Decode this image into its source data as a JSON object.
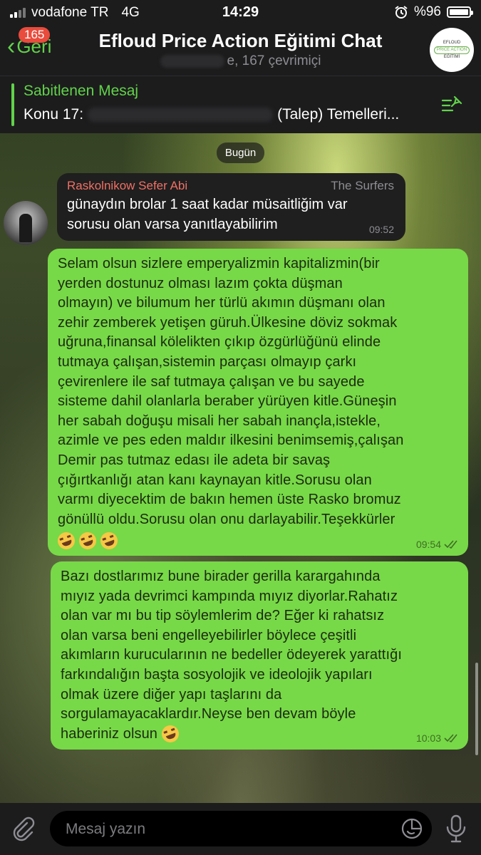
{
  "status_bar": {
    "carrier": "vodafone TR",
    "network": "4G",
    "time": "14:29",
    "battery": "%96"
  },
  "header": {
    "back_label": "Geri",
    "unread_badge": "165",
    "title": "Efloud Price Action Eğitimi Chat",
    "subtitle_visible": "e, 167 çevrimiçi",
    "avatar_text": [
      "EFLOUD",
      "PRICE ACTION",
      "EĞİTİMİ"
    ]
  },
  "pinned": {
    "title": "Sabitlenen Mesaj",
    "text_start": "Konu 17:",
    "text_end": "(Talep)  Temelleri..."
  },
  "date_separator": "Bugün",
  "messages": [
    {
      "sender": "Raskolnikow Sefer Abi",
      "tag": "The Surfers",
      "lines": [
        "günaydın brolar 1 saat kadar müsaitliğim var",
        "sorusu olan varsa yanıtlayabilirim"
      ],
      "time": "09:52"
    },
    {
      "lines": [
        "Selam olsun sizlere emperyalizmin kapitalizmin(bir",
        "yerden dostunuz olması lazım çokta düşman",
        "olmayın) ve bilumum her türlü akımın düşmanı olan",
        "zehir zemberek yetişen güruh.Ülkesine döviz sokmak",
        "uğruna,finansal kölelikten çıkıp özgürlüğünü elinde",
        "tutmaya çalışan,sistemin parçası olmayıp çarkı",
        "çevirenlere ile saf tutmaya çalışan ve bu sayede",
        "sisteme dahil olanlarla beraber yürüyen kitle.Güneşin",
        "her sabah doğuşu misali her sabah inançla,istekle,",
        "azimle ve pes eden maldır ilkesini benimsemiş,çalışan",
        "Demir pas tutmaz edası ile adeta bir savaş",
        "çığırtkanlığı atan kanı kaynayan kitle.Sorusu olan",
        "varmı diyecektim de bakın hemen üste Rasko bromuz",
        "gönüllü oldu.Sorusu olan onu darlayabilir.Teşekkürler"
      ],
      "emoji_count": 3,
      "time": "09:54"
    },
    {
      "lines": [
        "Bazı dostlarımız bune birader gerilla karargahında",
        "mıyız yada devrimci kampında mıyız diyorlar.Rahatız",
        "olan var mı bu tip söylemlerim de? Eğer ki rahatsız",
        "olan varsa beni engelleyebilirler böylece çeşitli",
        "akımların kurucularının ne bedeller ödeyerek yarattığı",
        "farkındalığın başta sosyolojik ve ideolojik yapıları",
        "olmak üzere diğer yapı taşlarını da",
        "sorgulamayacaklardır.Neyse ben devam böyle",
        "haberiniz olsun"
      ],
      "time": "10:03"
    }
  ],
  "input": {
    "placeholder": "Mesaj yazın"
  },
  "icons": [
    "chevron-left-icon",
    "pin-list-icon",
    "paperclip-icon",
    "sticker-icon",
    "microphone-icon",
    "double-check-icon",
    "alarm-icon",
    "rofl-emoji-icon"
  ],
  "colors": {
    "accent": "#62d34a",
    "outgoing_bubble": "#77d947",
    "incoming_bubble": "#1f1f1f",
    "sender_name": "#f07064",
    "badge": "#e94b3c"
  }
}
